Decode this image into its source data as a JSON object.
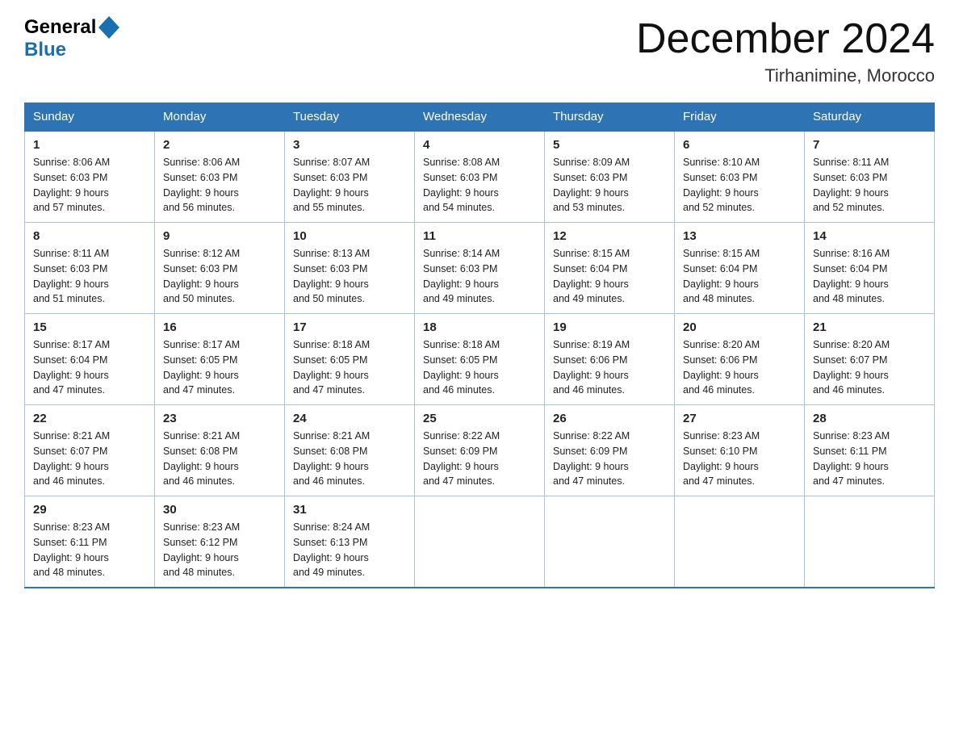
{
  "header": {
    "logo": {
      "general": "General",
      "blue": "Blue"
    },
    "title": "December 2024",
    "subtitle": "Tirhanimine, Morocco"
  },
  "weekdays": [
    "Sunday",
    "Monday",
    "Tuesday",
    "Wednesday",
    "Thursday",
    "Friday",
    "Saturday"
  ],
  "weeks": [
    [
      {
        "day": "1",
        "sunrise": "8:06 AM",
        "sunset": "6:03 PM",
        "daylight": "9 hours and 57 minutes."
      },
      {
        "day": "2",
        "sunrise": "8:06 AM",
        "sunset": "6:03 PM",
        "daylight": "9 hours and 56 minutes."
      },
      {
        "day": "3",
        "sunrise": "8:07 AM",
        "sunset": "6:03 PM",
        "daylight": "9 hours and 55 minutes."
      },
      {
        "day": "4",
        "sunrise": "8:08 AM",
        "sunset": "6:03 PM",
        "daylight": "9 hours and 54 minutes."
      },
      {
        "day": "5",
        "sunrise": "8:09 AM",
        "sunset": "6:03 PM",
        "daylight": "9 hours and 53 minutes."
      },
      {
        "day": "6",
        "sunrise": "8:10 AM",
        "sunset": "6:03 PM",
        "daylight": "9 hours and 52 minutes."
      },
      {
        "day": "7",
        "sunrise": "8:11 AM",
        "sunset": "6:03 PM",
        "daylight": "9 hours and 52 minutes."
      }
    ],
    [
      {
        "day": "8",
        "sunrise": "8:11 AM",
        "sunset": "6:03 PM",
        "daylight": "9 hours and 51 minutes."
      },
      {
        "day": "9",
        "sunrise": "8:12 AM",
        "sunset": "6:03 PM",
        "daylight": "9 hours and 50 minutes."
      },
      {
        "day": "10",
        "sunrise": "8:13 AM",
        "sunset": "6:03 PM",
        "daylight": "9 hours and 50 minutes."
      },
      {
        "day": "11",
        "sunrise": "8:14 AM",
        "sunset": "6:03 PM",
        "daylight": "9 hours and 49 minutes."
      },
      {
        "day": "12",
        "sunrise": "8:15 AM",
        "sunset": "6:04 PM",
        "daylight": "9 hours and 49 minutes."
      },
      {
        "day": "13",
        "sunrise": "8:15 AM",
        "sunset": "6:04 PM",
        "daylight": "9 hours and 48 minutes."
      },
      {
        "day": "14",
        "sunrise": "8:16 AM",
        "sunset": "6:04 PM",
        "daylight": "9 hours and 48 minutes."
      }
    ],
    [
      {
        "day": "15",
        "sunrise": "8:17 AM",
        "sunset": "6:04 PM",
        "daylight": "9 hours and 47 minutes."
      },
      {
        "day": "16",
        "sunrise": "8:17 AM",
        "sunset": "6:05 PM",
        "daylight": "9 hours and 47 minutes."
      },
      {
        "day": "17",
        "sunrise": "8:18 AM",
        "sunset": "6:05 PM",
        "daylight": "9 hours and 47 minutes."
      },
      {
        "day": "18",
        "sunrise": "8:18 AM",
        "sunset": "6:05 PM",
        "daylight": "9 hours and 46 minutes."
      },
      {
        "day": "19",
        "sunrise": "8:19 AM",
        "sunset": "6:06 PM",
        "daylight": "9 hours and 46 minutes."
      },
      {
        "day": "20",
        "sunrise": "8:20 AM",
        "sunset": "6:06 PM",
        "daylight": "9 hours and 46 minutes."
      },
      {
        "day": "21",
        "sunrise": "8:20 AM",
        "sunset": "6:07 PM",
        "daylight": "9 hours and 46 minutes."
      }
    ],
    [
      {
        "day": "22",
        "sunrise": "8:21 AM",
        "sunset": "6:07 PM",
        "daylight": "9 hours and 46 minutes."
      },
      {
        "day": "23",
        "sunrise": "8:21 AM",
        "sunset": "6:08 PM",
        "daylight": "9 hours and 46 minutes."
      },
      {
        "day": "24",
        "sunrise": "8:21 AM",
        "sunset": "6:08 PM",
        "daylight": "9 hours and 46 minutes."
      },
      {
        "day": "25",
        "sunrise": "8:22 AM",
        "sunset": "6:09 PM",
        "daylight": "9 hours and 47 minutes."
      },
      {
        "day": "26",
        "sunrise": "8:22 AM",
        "sunset": "6:09 PM",
        "daylight": "9 hours and 47 minutes."
      },
      {
        "day": "27",
        "sunrise": "8:23 AM",
        "sunset": "6:10 PM",
        "daylight": "9 hours and 47 minutes."
      },
      {
        "day": "28",
        "sunrise": "8:23 AM",
        "sunset": "6:11 PM",
        "daylight": "9 hours and 47 minutes."
      }
    ],
    [
      {
        "day": "29",
        "sunrise": "8:23 AM",
        "sunset": "6:11 PM",
        "daylight": "9 hours and 48 minutes."
      },
      {
        "day": "30",
        "sunrise": "8:23 AM",
        "sunset": "6:12 PM",
        "daylight": "9 hours and 48 minutes."
      },
      {
        "day": "31",
        "sunrise": "8:24 AM",
        "sunset": "6:13 PM",
        "daylight": "9 hours and 49 minutes."
      },
      null,
      null,
      null,
      null
    ]
  ],
  "labels": {
    "sunrise": "Sunrise:",
    "sunset": "Sunset:",
    "daylight": "Daylight:"
  }
}
